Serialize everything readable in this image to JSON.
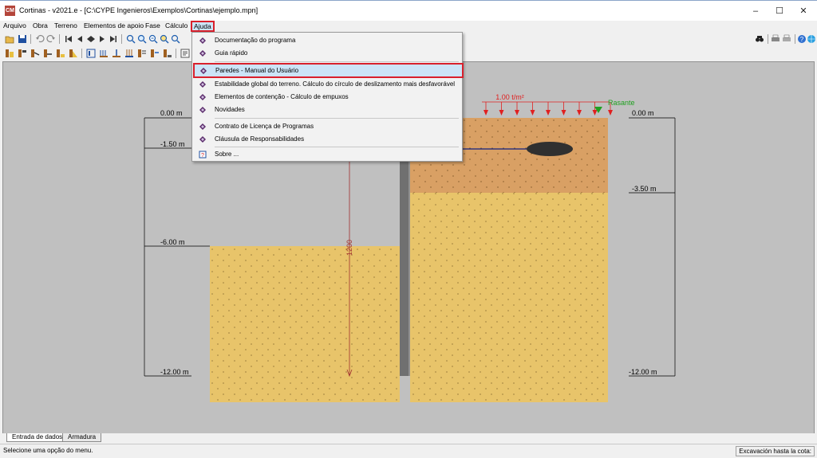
{
  "window": {
    "title": "Cortinas - v2021.e - [C:\\CYPE Ingenieros\\Exemplos\\Cortinas\\ejemplo.mpn]",
    "app_badge": "CM",
    "minimize": "–",
    "maximize": "☐",
    "close": "✕"
  },
  "menubar": {
    "items": [
      {
        "label": "Arquivo"
      },
      {
        "label": "Obra"
      },
      {
        "label": "Terreno"
      },
      {
        "label": "Elementos de apoio"
      },
      {
        "label": "Fase"
      },
      {
        "label": "Cálculo"
      },
      {
        "label": "Ajuda"
      }
    ]
  },
  "help_menu": {
    "items": [
      {
        "label": "Documentação do programa"
      },
      {
        "label": "Guia rápido"
      },
      {
        "label": "Paredes - Manual do Usuário"
      },
      {
        "label": "Estabilidade global do terreno. Cálculo do círculo de deslizamento mais desfavorável"
      },
      {
        "label": "Elementos de contenção - Cálculo de empuxos"
      },
      {
        "label": "Novidades"
      },
      {
        "label": "Contrato de Licença de Programas"
      },
      {
        "label": "Cláusula de Responsabilidades"
      },
      {
        "label": "Sobre ..."
      }
    ]
  },
  "drawing": {
    "left_levels": [
      "0.00 m",
      "-1.50 m",
      "-6.00 m",
      "-12.00 m"
    ],
    "right_levels": [
      "0.00 m",
      "-3.50 m",
      "-12.00 m"
    ],
    "load_label": "1.00 t/m²",
    "rasante_label": "Rasante",
    "wall_length_label": "1200",
    "colors": {
      "background": "#c0c0c0",
      "upper_soil": "#d9a064",
      "lower_soil": "#e8c46a",
      "wall": "#707070",
      "load_arrows": "#e02020",
      "rasante": "#20a020",
      "dimension": "#a03030",
      "anchor": "#303030",
      "anchor_line": "#102080"
    }
  },
  "tabs": [
    {
      "label": "Entrada de dados"
    },
    {
      "label": "Armadura"
    }
  ],
  "status": {
    "message": "Selecione uma opção do menu.",
    "right": "Excavación hasta la cota:"
  }
}
